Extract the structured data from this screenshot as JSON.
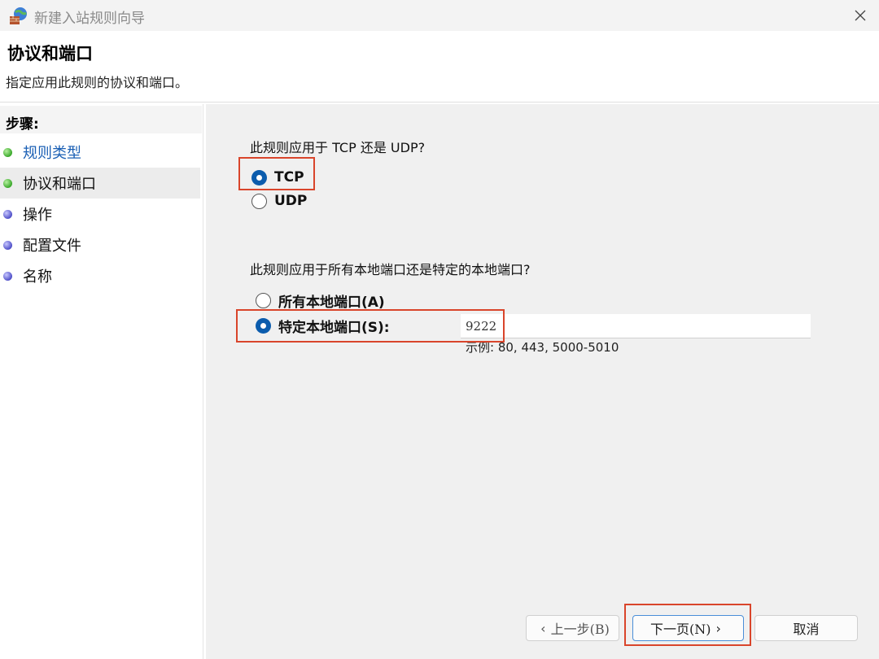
{
  "window": {
    "title": "新建入站规则向导",
    "icon": "firewall-wizard-icon",
    "close_icon": "close-icon"
  },
  "header": {
    "title": "协议和端口",
    "subtitle": "指定应用此规则的协议和端口。"
  },
  "steps": {
    "heading": "步骤:",
    "items": [
      {
        "label": "规则类型",
        "status": "completed",
        "dot_color": "#3aa82a"
      },
      {
        "label": "协议和端口",
        "status": "current",
        "dot_color": "#3aa82a"
      },
      {
        "label": "操作",
        "status": "pending",
        "dot_color": "#5050c8"
      },
      {
        "label": "配置文件",
        "status": "pending",
        "dot_color": "#5050c8"
      },
      {
        "label": "名称",
        "status": "pending",
        "dot_color": "#5050c8"
      }
    ]
  },
  "protocol": {
    "question": "此规则应用于 TCP 还是 UDP?",
    "options": [
      {
        "label": "TCP",
        "checked": true
      },
      {
        "label": "UDP",
        "checked": false
      }
    ]
  },
  "ports": {
    "question": "此规则应用于所有本地端口还是特定的本地端口?",
    "options": [
      {
        "label": "所有本地端口(A)",
        "checked": false
      },
      {
        "label": "特定本地端口(S):",
        "checked": true
      }
    ],
    "value": "9222",
    "example": "示例: 80, 443, 5000-5010"
  },
  "buttons": {
    "back_label": "上一步(B)",
    "next_label": "下一页(N)",
    "cancel_label": "取消"
  },
  "colors": {
    "accent": "#0b5cad",
    "highlight": "#d9452b",
    "link": "#1a5fb4"
  }
}
